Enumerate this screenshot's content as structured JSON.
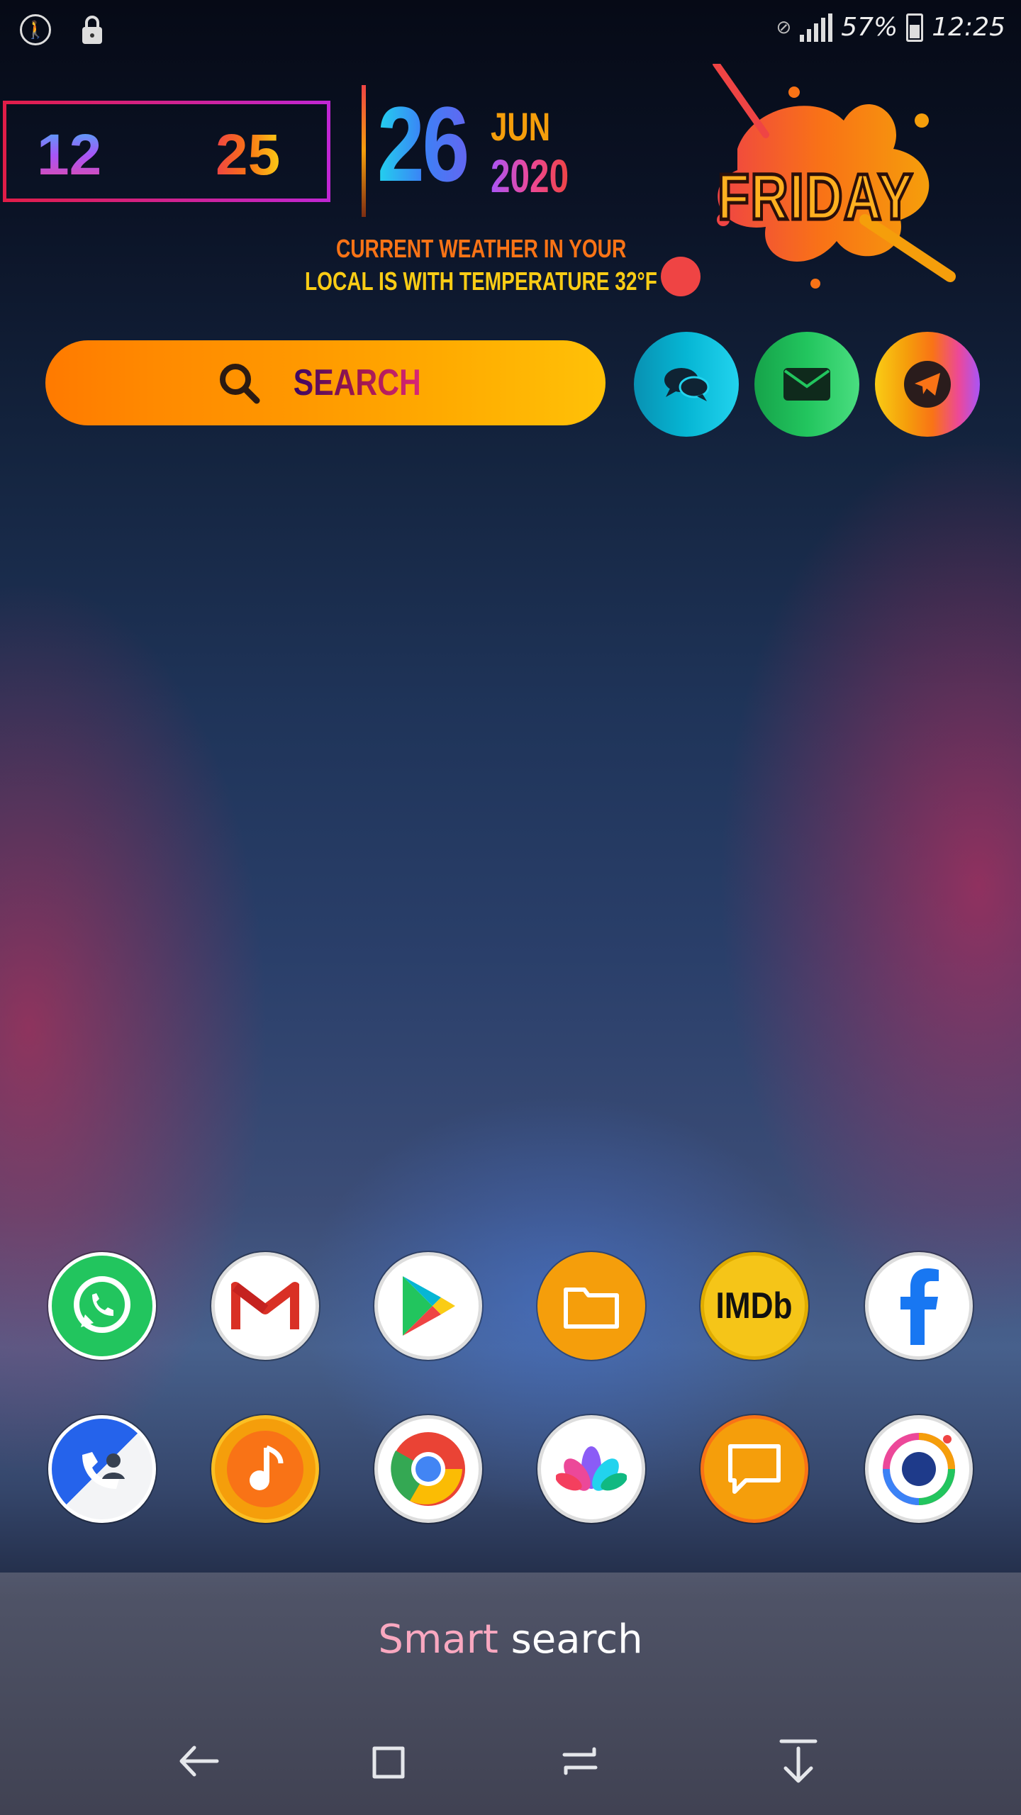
{
  "status_bar": {
    "battery": "57%",
    "time": "12:25",
    "icons": [
      "accessibility-icon",
      "lock-icon",
      "no-sim-icon",
      "signal-icon",
      "battery-icon"
    ]
  },
  "clock_widget": {
    "hours": "12",
    "minutes": "25",
    "day": "26",
    "month": "JUN",
    "year": "2020",
    "weekday": "FRIDAY",
    "weather_line1": "CURRENT WEATHER IN YOUR",
    "weather_line2": "LOCAL IS  WITH TEMPERATURE 32°F"
  },
  "search": {
    "label": "SEARCH"
  },
  "quick_buttons": [
    {
      "name": "chat-icon",
      "color": "#06b6d4"
    },
    {
      "name": "mail-icon",
      "color": "#22c55e"
    },
    {
      "name": "telegram-icon",
      "color": "#f59e0b"
    }
  ],
  "apps_row1": [
    "WhatsApp",
    "Gmail",
    "Play Store",
    "Files",
    "IMDb",
    "Facebook"
  ],
  "apps_row2": [
    "Phone",
    "Music",
    "Chrome",
    "Gallery",
    "Messages",
    "Camera"
  ],
  "imdb_text": "IMDb",
  "dock": {
    "smart": "Smart",
    "search": "search"
  },
  "nav": [
    "back-icon",
    "recents-icon",
    "switch-icon",
    "hide-icon"
  ]
}
